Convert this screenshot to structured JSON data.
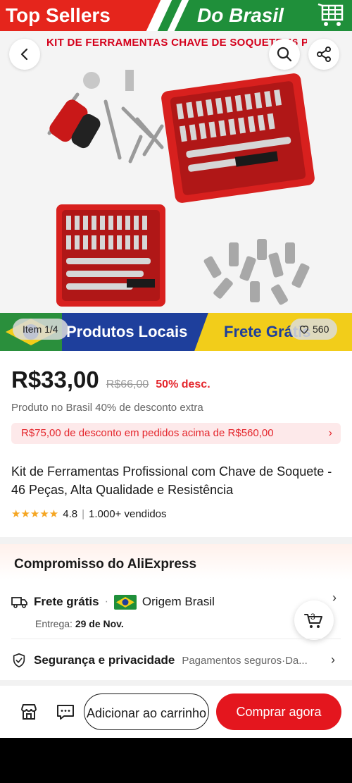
{
  "hero": {
    "banner_left": "Top Sellers",
    "banner_right": "Do Brasil",
    "photo_title": "KIT DE FERRAMENTAS CHAVE DE SOQUETE 46 PÇS",
    "bottom_mid": "Produtos Locais",
    "bottom_right": "Frete Grátis",
    "item_indicator": "Item 1/4",
    "likes": "560"
  },
  "product": {
    "price": "R$33,00",
    "old_price": "R$66,00",
    "discount": "50% desc.",
    "extra_discount": "Produto no Brasil 40% de desconto extra",
    "coupon": "R$75,00 de desconto em pedidos acima de R$560,00",
    "title": "Kit de Ferramentas Profissional com Chave de Soquete - 46 Peças, Alta Qualidade e Resistência",
    "rating": "4.8",
    "sold": "1.000+ vendidos",
    "stars": "★★★★★"
  },
  "commitment": {
    "title": "Compromisso do AliExpress",
    "shipping_label": "Frete grátis",
    "shipping_origin": "Origem Brasil",
    "delivery_label": "Entrega:",
    "delivery_date": "29 de Nov.",
    "security_label": "Segurança e privacidade",
    "security_value": "Pagamentos seguros·Da...",
    "cart_count": "3"
  },
  "actions": {
    "add_to_cart": "Adicionar ao carrinho",
    "buy_now": "Comprar agora"
  },
  "colors": {
    "accent": "#e4161e",
    "discount": "#e4262c",
    "star": "#f5a623"
  }
}
